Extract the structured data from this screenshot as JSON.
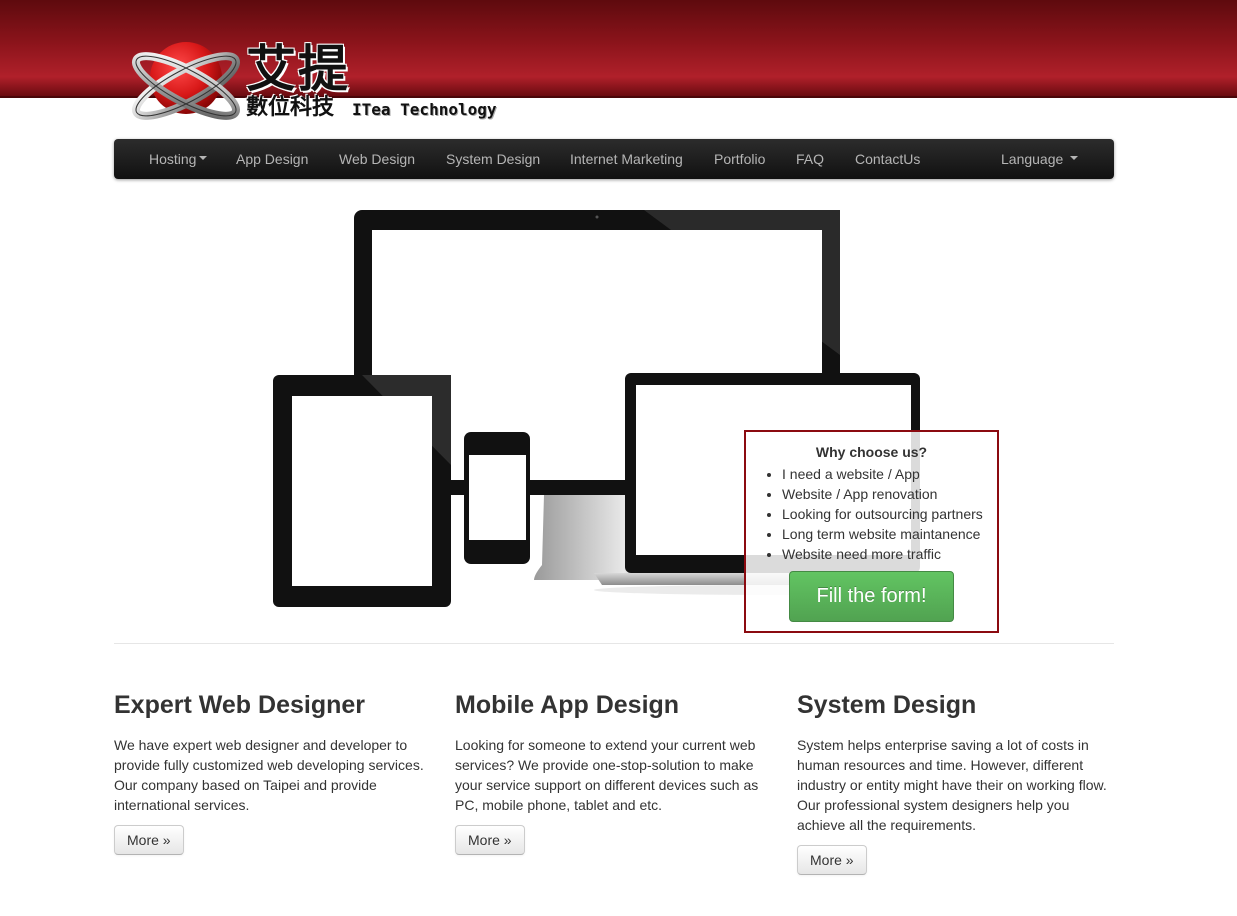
{
  "logo": {
    "cn_name": "艾提",
    "cn_subtitle": "數位科技",
    "en_name": "ITea Technology"
  },
  "nav": {
    "items": [
      {
        "label": "Hosting",
        "dropdown": true
      },
      {
        "label": "App Design"
      },
      {
        "label": "Web Design"
      },
      {
        "label": "System Design"
      },
      {
        "label": "Internet Marketing"
      },
      {
        "label": "Portfolio"
      },
      {
        "label": "FAQ"
      },
      {
        "label": "ContactUs"
      }
    ],
    "language": {
      "label": "Language",
      "dropdown": true
    }
  },
  "why": {
    "title": "Why choose us?",
    "items": [
      "I need a website / App",
      "Website / App renovation",
      "Looking for outsourcing partners",
      "Long term website maintanence",
      "Website need more traffic"
    ],
    "button": "Fill the form!"
  },
  "features": [
    {
      "title": "Expert Web Designer",
      "text": "We have expert web designer and developer to provide fully customized web developing services. Our company based on Taipei and provide international services.",
      "button": "More »"
    },
    {
      "title": "Mobile App Design",
      "text": "Looking for someone to extend your current web services? We provide one-stop-solution to make your service support on different devices such as PC, mobile phone, tablet and etc.",
      "button": "More »"
    },
    {
      "title": "System Design",
      "text": "System helps enterprise saving a lot of costs in human resources and time. However, different industry or entity might have their on working flow. Our professional system designers help you achieve all the requirements.",
      "button": "More »"
    }
  ],
  "colors": {
    "brand_red": "#8c141b",
    "navbar": "#1b1b1b",
    "nav_text": "#b5b5b5",
    "cta_green": "#51a351",
    "box_border": "#8b0a10"
  }
}
